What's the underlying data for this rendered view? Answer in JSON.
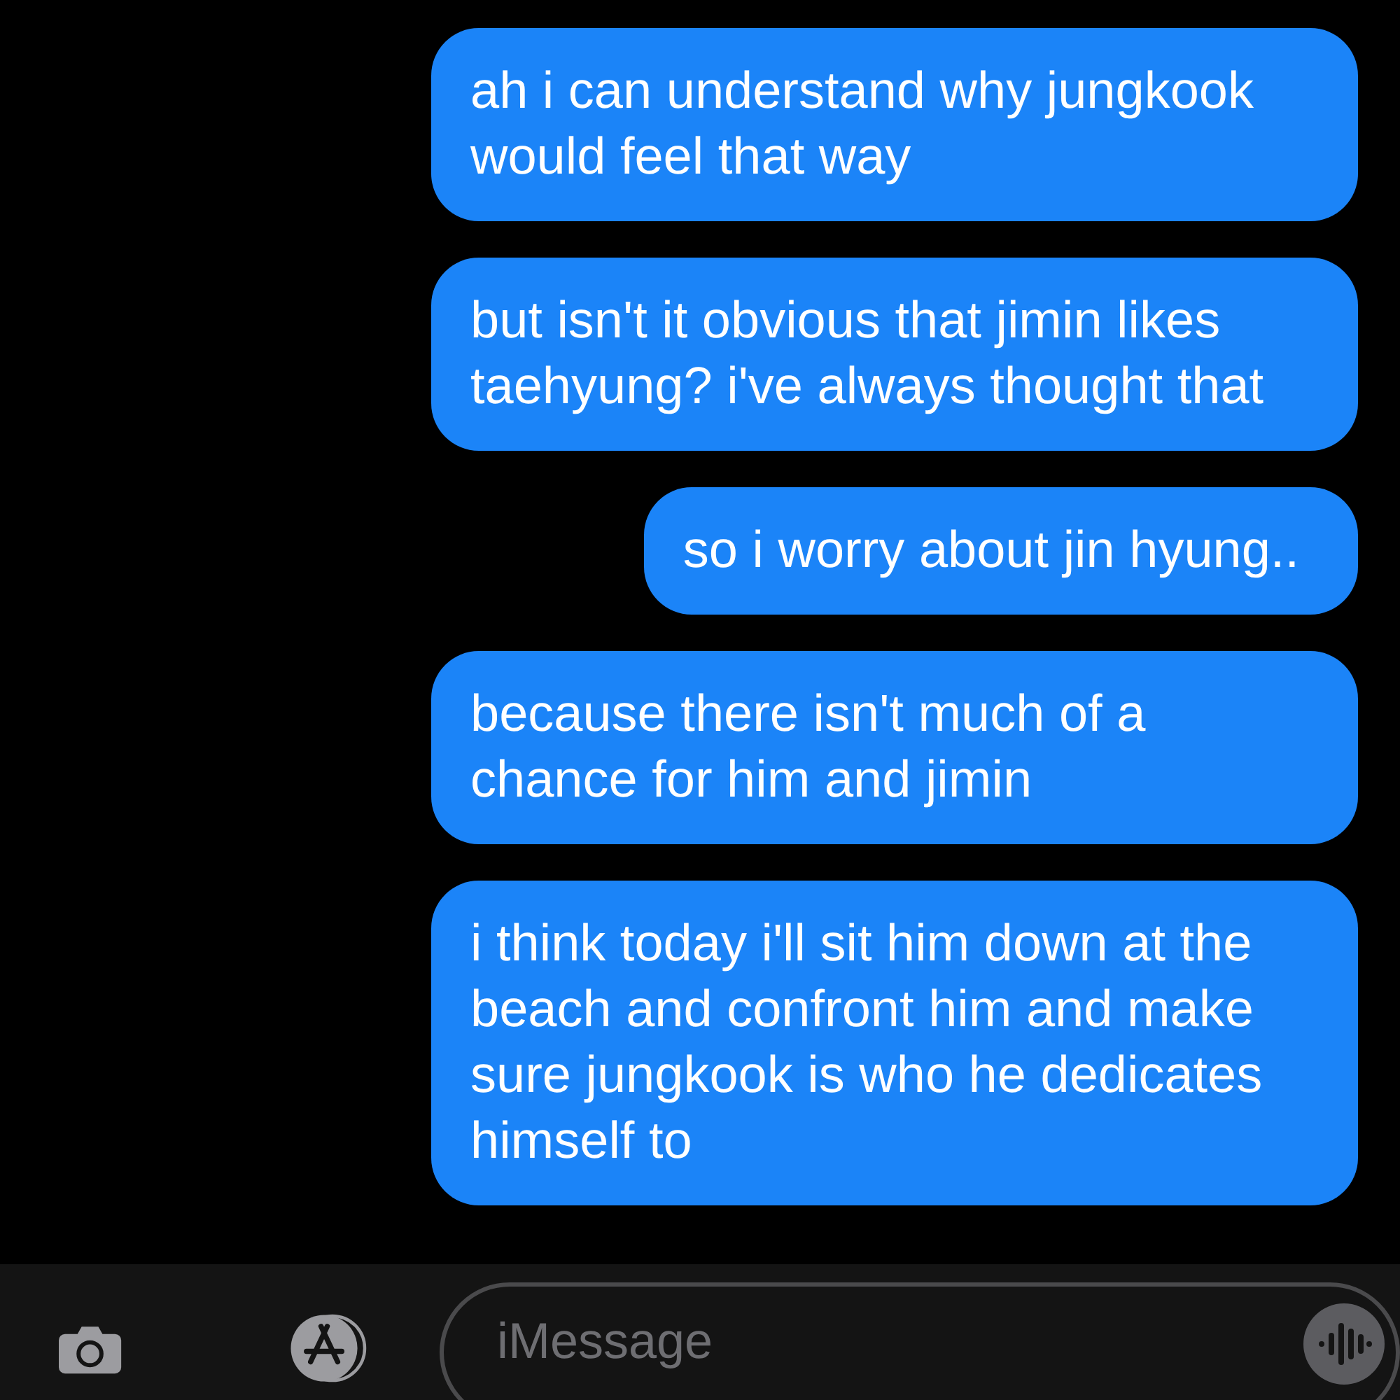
{
  "messages": [
    {
      "text": "ah i can understand why jungkook would feel that way",
      "outgoing": true
    },
    {
      "text": "but isn't it obvious that jimin likes taehyung? i've always thought that",
      "outgoing": true
    },
    {
      "text": "so i worry about jin hyung..",
      "outgoing": true
    },
    {
      "text": "because there isn't much of a chance for him and jimin",
      "outgoing": true
    },
    {
      "text": "i think today i'll sit him down at the beach and confront him and make sure jungkook is who he dedicates himself to",
      "outgoing": true
    }
  ],
  "compose": {
    "placeholder": "iMessage"
  }
}
